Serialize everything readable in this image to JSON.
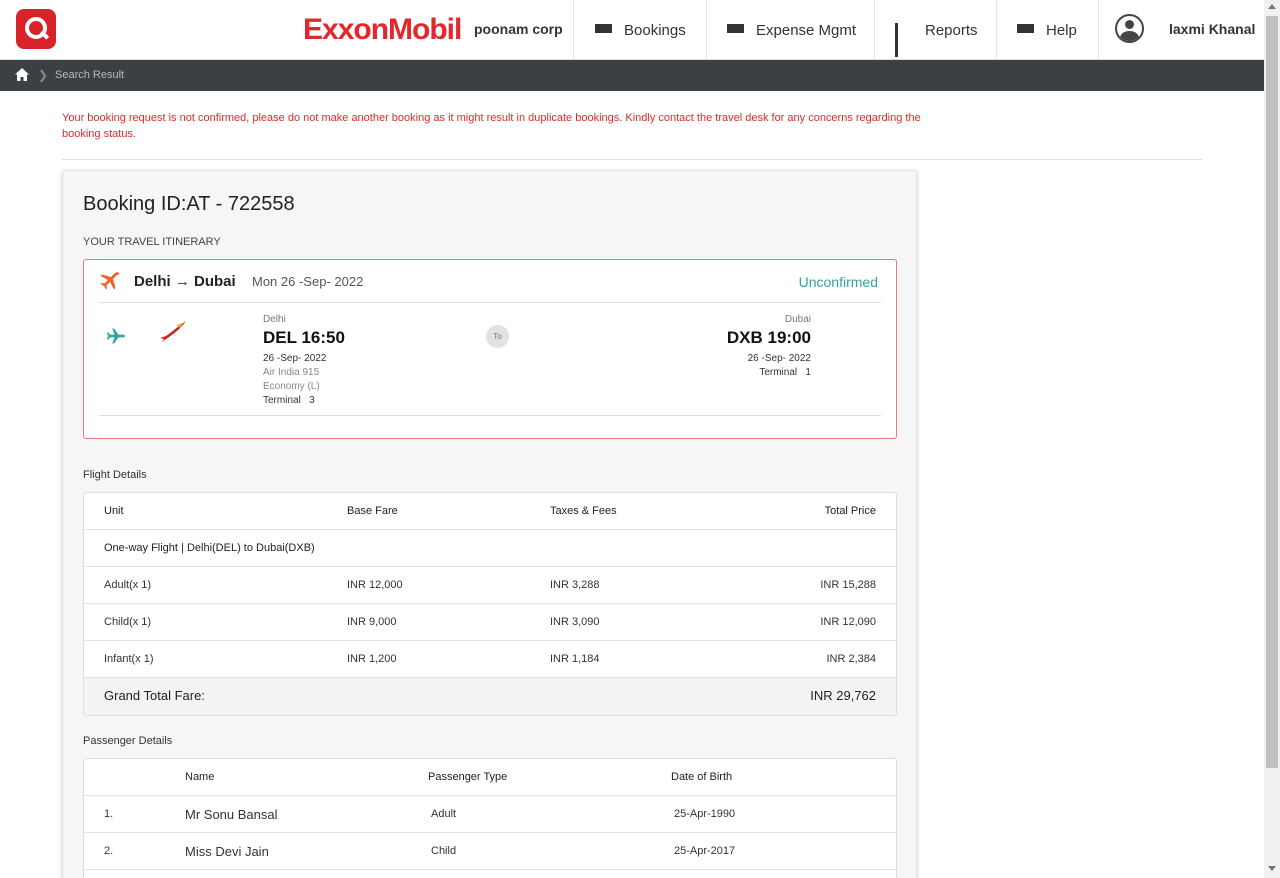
{
  "header": {
    "brand": "ExxonMobil",
    "corp": "poonam corp",
    "nav": [
      {
        "label": "Bookings",
        "icon": "menu-icon"
      },
      {
        "label": "Expense Mgmt",
        "icon": "menu-icon"
      },
      {
        "label": "Reports",
        "icon": "bar-chart-icon"
      },
      {
        "label": "Help",
        "icon": "menu-icon"
      }
    ],
    "user": "laxmi Khanal"
  },
  "breadcrumb": {
    "current": "Search Result"
  },
  "warning": "Your booking request is not confirmed, please do not make another booking as it might result in duplicate bookings. Kindly contact the travel desk for any concerns regarding the booking status.",
  "booking": {
    "id_label": "Booking ID:AT - 722558",
    "itinerary_title": "YOUR TRAVEL ITINERARY",
    "route": "Delhi → Dubai",
    "date": "Mon 26 -Sep- 2022",
    "status": "Unconfirmed",
    "status_color": "#36a3a0",
    "departure": {
      "city": "Delhi",
      "code_time": "DEL 16:50",
      "date": "26 -Sep- 2022",
      "flight": "Air India 915",
      "cabin": "Economy (L)",
      "terminal": "Terminal   3"
    },
    "to_label": "To",
    "arrival": {
      "city": "Dubai",
      "code_time": "DXB 19:00",
      "date": "26 -Sep- 2022",
      "terminal": "Terminal   1"
    }
  },
  "flight_details": {
    "title": "Flight Details",
    "headers": [
      "Unit",
      "Base Fare",
      "Taxes & Fees",
      "Total Price"
    ],
    "route_row": "One-way Flight | Delhi(DEL) to Dubai(DXB)",
    "rows": [
      {
        "unit": "Adult(x 1)",
        "base": "INR 12,000",
        "tax": "INR 3,288",
        "total": "INR 15,288"
      },
      {
        "unit": "Child(x 1)",
        "base": "INR 9,000",
        "tax": "INR 3,090",
        "total": "INR 12,090"
      },
      {
        "unit": "Infant(x 1)",
        "base": "INR 1,200",
        "tax": "INR 1,184",
        "total": "INR 2,384"
      }
    ],
    "grand_total_label": "Grand Total Fare:",
    "grand_total": "INR 29,762"
  },
  "passenger_details": {
    "title": "Passenger Details",
    "headers": [
      "Name",
      "Passenger Type",
      "Date of Birth"
    ],
    "rows": [
      {
        "num": "1.",
        "name": "Mr Sonu Bansal",
        "type": "Adult",
        "dob": "25-Apr-1990"
      },
      {
        "num": "2.",
        "name": "Miss Devi Jain",
        "type": "Child",
        "dob": "25-Apr-2017"
      }
    ]
  },
  "colors": {
    "accent": "#e3272c",
    "dark_bar": "#3d4043",
    "warning": "#e12a2a"
  }
}
